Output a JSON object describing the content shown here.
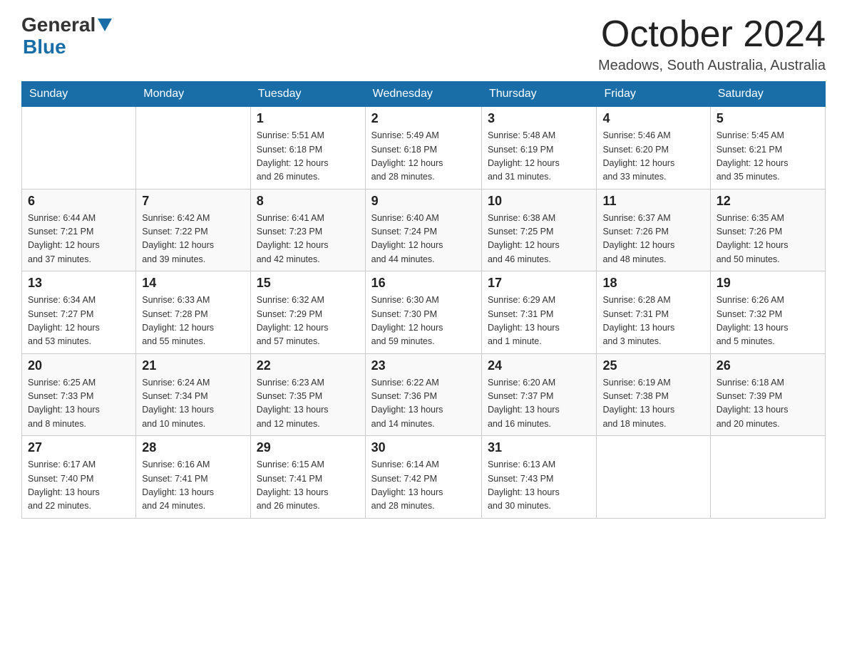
{
  "logo": {
    "general": "General",
    "blue": "Blue"
  },
  "header": {
    "month_year": "October 2024",
    "location": "Meadows, South Australia, Australia"
  },
  "weekdays": [
    "Sunday",
    "Monday",
    "Tuesday",
    "Wednesday",
    "Thursday",
    "Friday",
    "Saturday"
  ],
  "weeks": [
    [
      {
        "day": "",
        "info": ""
      },
      {
        "day": "",
        "info": ""
      },
      {
        "day": "1",
        "info": "Sunrise: 5:51 AM\nSunset: 6:18 PM\nDaylight: 12 hours\nand 26 minutes."
      },
      {
        "day": "2",
        "info": "Sunrise: 5:49 AM\nSunset: 6:18 PM\nDaylight: 12 hours\nand 28 minutes."
      },
      {
        "day": "3",
        "info": "Sunrise: 5:48 AM\nSunset: 6:19 PM\nDaylight: 12 hours\nand 31 minutes."
      },
      {
        "day": "4",
        "info": "Sunrise: 5:46 AM\nSunset: 6:20 PM\nDaylight: 12 hours\nand 33 minutes."
      },
      {
        "day": "5",
        "info": "Sunrise: 5:45 AM\nSunset: 6:21 PM\nDaylight: 12 hours\nand 35 minutes."
      }
    ],
    [
      {
        "day": "6",
        "info": "Sunrise: 6:44 AM\nSunset: 7:21 PM\nDaylight: 12 hours\nand 37 minutes."
      },
      {
        "day": "7",
        "info": "Sunrise: 6:42 AM\nSunset: 7:22 PM\nDaylight: 12 hours\nand 39 minutes."
      },
      {
        "day": "8",
        "info": "Sunrise: 6:41 AM\nSunset: 7:23 PM\nDaylight: 12 hours\nand 42 minutes."
      },
      {
        "day": "9",
        "info": "Sunrise: 6:40 AM\nSunset: 7:24 PM\nDaylight: 12 hours\nand 44 minutes."
      },
      {
        "day": "10",
        "info": "Sunrise: 6:38 AM\nSunset: 7:25 PM\nDaylight: 12 hours\nand 46 minutes."
      },
      {
        "day": "11",
        "info": "Sunrise: 6:37 AM\nSunset: 7:26 PM\nDaylight: 12 hours\nand 48 minutes."
      },
      {
        "day": "12",
        "info": "Sunrise: 6:35 AM\nSunset: 7:26 PM\nDaylight: 12 hours\nand 50 minutes."
      }
    ],
    [
      {
        "day": "13",
        "info": "Sunrise: 6:34 AM\nSunset: 7:27 PM\nDaylight: 12 hours\nand 53 minutes."
      },
      {
        "day": "14",
        "info": "Sunrise: 6:33 AM\nSunset: 7:28 PM\nDaylight: 12 hours\nand 55 minutes."
      },
      {
        "day": "15",
        "info": "Sunrise: 6:32 AM\nSunset: 7:29 PM\nDaylight: 12 hours\nand 57 minutes."
      },
      {
        "day": "16",
        "info": "Sunrise: 6:30 AM\nSunset: 7:30 PM\nDaylight: 12 hours\nand 59 minutes."
      },
      {
        "day": "17",
        "info": "Sunrise: 6:29 AM\nSunset: 7:31 PM\nDaylight: 13 hours\nand 1 minute."
      },
      {
        "day": "18",
        "info": "Sunrise: 6:28 AM\nSunset: 7:31 PM\nDaylight: 13 hours\nand 3 minutes."
      },
      {
        "day": "19",
        "info": "Sunrise: 6:26 AM\nSunset: 7:32 PM\nDaylight: 13 hours\nand 5 minutes."
      }
    ],
    [
      {
        "day": "20",
        "info": "Sunrise: 6:25 AM\nSunset: 7:33 PM\nDaylight: 13 hours\nand 8 minutes."
      },
      {
        "day": "21",
        "info": "Sunrise: 6:24 AM\nSunset: 7:34 PM\nDaylight: 13 hours\nand 10 minutes."
      },
      {
        "day": "22",
        "info": "Sunrise: 6:23 AM\nSunset: 7:35 PM\nDaylight: 13 hours\nand 12 minutes."
      },
      {
        "day": "23",
        "info": "Sunrise: 6:22 AM\nSunset: 7:36 PM\nDaylight: 13 hours\nand 14 minutes."
      },
      {
        "day": "24",
        "info": "Sunrise: 6:20 AM\nSunset: 7:37 PM\nDaylight: 13 hours\nand 16 minutes."
      },
      {
        "day": "25",
        "info": "Sunrise: 6:19 AM\nSunset: 7:38 PM\nDaylight: 13 hours\nand 18 minutes."
      },
      {
        "day": "26",
        "info": "Sunrise: 6:18 AM\nSunset: 7:39 PM\nDaylight: 13 hours\nand 20 minutes."
      }
    ],
    [
      {
        "day": "27",
        "info": "Sunrise: 6:17 AM\nSunset: 7:40 PM\nDaylight: 13 hours\nand 22 minutes."
      },
      {
        "day": "28",
        "info": "Sunrise: 6:16 AM\nSunset: 7:41 PM\nDaylight: 13 hours\nand 24 minutes."
      },
      {
        "day": "29",
        "info": "Sunrise: 6:15 AM\nSunset: 7:41 PM\nDaylight: 13 hours\nand 26 minutes."
      },
      {
        "day": "30",
        "info": "Sunrise: 6:14 AM\nSunset: 7:42 PM\nDaylight: 13 hours\nand 28 minutes."
      },
      {
        "day": "31",
        "info": "Sunrise: 6:13 AM\nSunset: 7:43 PM\nDaylight: 13 hours\nand 30 minutes."
      },
      {
        "day": "",
        "info": ""
      },
      {
        "day": "",
        "info": ""
      }
    ]
  ]
}
